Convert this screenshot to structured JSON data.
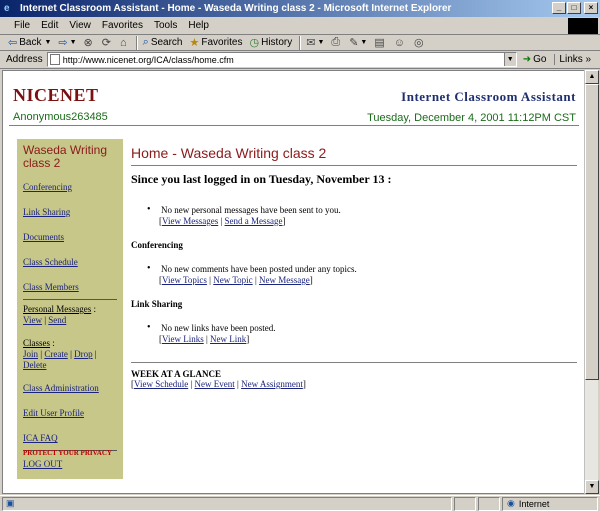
{
  "window": {
    "title": "Internet Classroom Assistant - Home - Waseda Writing class 2 - Microsoft Internet Explorer",
    "controls": [
      "_",
      "□",
      "×"
    ]
  },
  "menu": [
    "File",
    "Edit",
    "View",
    "Favorites",
    "Tools",
    "Help"
  ],
  "toolbar": {
    "back": "Back",
    "search": "Search",
    "favorites": "Favorites",
    "history": "History"
  },
  "address": {
    "label": "Address",
    "value": "http://www.nicenet.org/ICA/class/home.cfm",
    "go": "Go",
    "links": "Links »"
  },
  "header": {
    "logo": "NICENET",
    "user": "Anonymous263485",
    "app_title": "Internet Classroom Assistant",
    "datetime": "Tuesday, December 4, 2001 11:12PM CST"
  },
  "sidebar": {
    "class_name": "Waseda Writing class 2",
    "links": [
      "Conferencing",
      "Link Sharing",
      "Documents",
      "Class Schedule",
      "Class Members"
    ],
    "personal_messages": {
      "label": "Personal Messages",
      "view": "View",
      "send": "Send"
    },
    "classes": {
      "label": "Classes",
      "join": "Join",
      "create": "Create",
      "drop": "Drop",
      "delete": "Delete"
    },
    "more_links": [
      "Class Administration",
      "Edit User Profile",
      "ICA FAQ"
    ],
    "privacy": "PROTECT YOUR PRIVACY",
    "logout": "LOG OUT"
  },
  "main": {
    "title": "Home - Waseda Writing class 2",
    "since": "Since you last logged in on Tuesday, November 13 :",
    "messages": {
      "text": "No new personal messages have been sent to you.",
      "view": "View Messages",
      "send": "Send a Message"
    },
    "conferencing": {
      "heading": "Conferencing",
      "text": "No new comments have been posted under any topics.",
      "view": "View Topics",
      "new_topic": "New Topic",
      "new_message": "New Message"
    },
    "link_sharing": {
      "heading": "Link Sharing",
      "text": "No new links have been posted.",
      "view": "View Links",
      "new_link": "New Link"
    },
    "week": {
      "heading": "WEEK AT A GLANCE",
      "view_schedule": "View Schedule",
      "new_event": "New Event",
      "new_assignment": "New Assignment"
    }
  },
  "status": {
    "zone": "Internet"
  }
}
